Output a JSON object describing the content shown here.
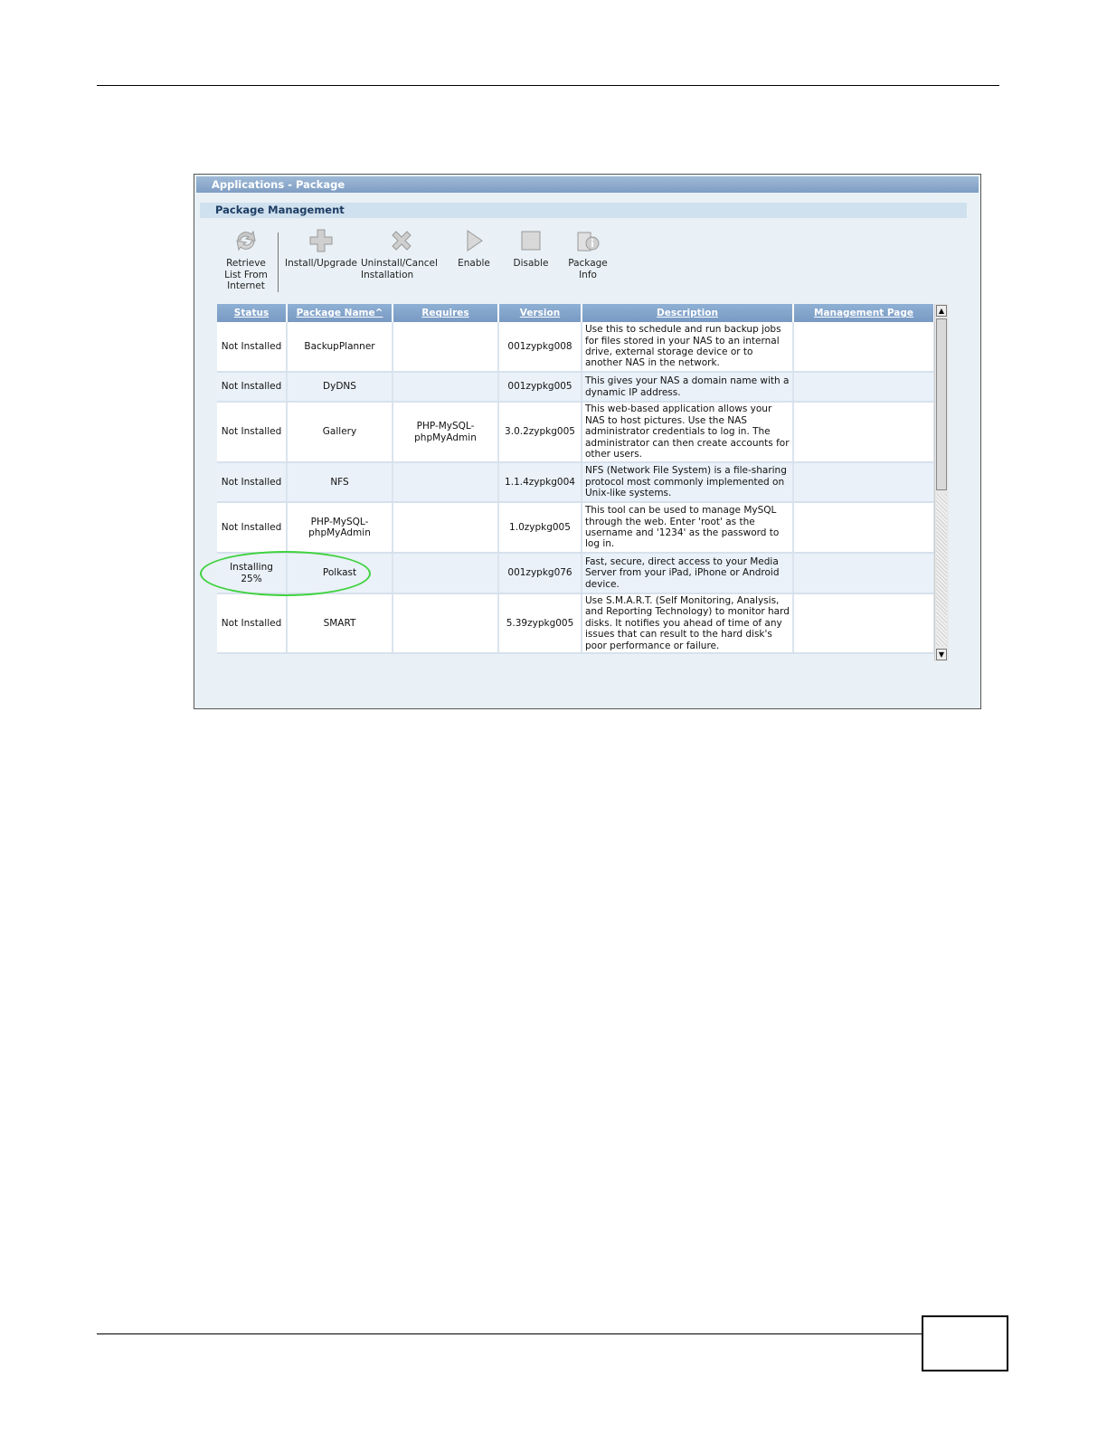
{
  "window": {
    "title": "Applications - Package"
  },
  "section": {
    "title": "Package Management"
  },
  "toolbar": [
    {
      "label": "Retrieve\nList From\nInternet",
      "icon": "refresh-icon"
    },
    {
      "label": "Install/Upgrade",
      "icon": "plus-icon"
    },
    {
      "label": "Uninstall/Cancel\nInstallation",
      "icon": "x-icon"
    },
    {
      "label": "Enable",
      "icon": "play-icon"
    },
    {
      "label": "Disable",
      "icon": "stop-icon"
    },
    {
      "label": "Package\nInfo",
      "icon": "info-icon"
    }
  ],
  "table": {
    "columns": [
      "Status",
      "Package Name^",
      "Requires",
      "Version",
      "Description",
      "Management Page"
    ],
    "rows": [
      {
        "status": "Not Installed",
        "name": "BackupPlanner",
        "requires": "",
        "version": "001zypkg008",
        "description": "Use this to schedule and run backup jobs for files stored in your NAS to an internal drive, external storage device or to another NAS in the network.",
        "management": ""
      },
      {
        "status": "Not Installed",
        "name": "DyDNS",
        "requires": "",
        "version": "001zypkg005",
        "description": "This gives your NAS a domain name with a dynamic IP address.",
        "management": ""
      },
      {
        "status": "Not Installed",
        "name": "Gallery",
        "requires": "PHP-MySQL-\nphpMyAdmin",
        "version": "3.0.2zypkg005",
        "description": "This web-based application allows your NAS to host pictures. Use the NAS administrator credentials to log in. The administrator can then create accounts for other users.",
        "management": ""
      },
      {
        "status": "Not Installed",
        "name": "NFS",
        "requires": "",
        "version": "1.1.4zypkg004",
        "description": "NFS (Network File System) is a file-sharing protocol most commonly implemented on Unix-like systems.",
        "management": ""
      },
      {
        "status": "Not Installed",
        "name": "PHP-MySQL-\nphpMyAdmin",
        "requires": "",
        "version": "1.0zypkg005",
        "description": "This tool can be used to manage MySQL through the web. Enter 'root' as the username and '1234' as the password to log in.",
        "management": ""
      },
      {
        "status": "Installing\n25%",
        "name": "Polkast",
        "requires": "",
        "version": "001zypkg076",
        "description": "Fast, secure, direct access to your Media Server from your iPad, iPhone or Android device.",
        "management": ""
      },
      {
        "status": "Not Installed",
        "name": "SMART",
        "requires": "",
        "version": "5.39zypkg005",
        "description": "Use S.M.A.R.T. (Self Monitoring, Analysis, and Reporting Technology) to monitor hard disks. It notifies you ahead of time of any issues that can result to the hard disk's poor performance or failure.",
        "management": ""
      }
    ]
  },
  "colors": {
    "highlight": "#3fd23f",
    "header": "#7f9dc3"
  }
}
